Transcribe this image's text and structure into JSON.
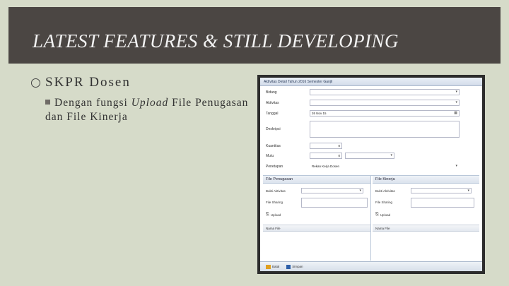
{
  "slide": {
    "title": "LATEST FEATURES & STILL DEVELOPING",
    "bullet_main": "SKPR Dosen",
    "bullet_sub_prefix": "Dengan fungsi ",
    "bullet_sub_emph": "Upload",
    "bullet_sub_suffix": " File Penugasan dan File Kinerja"
  },
  "window": {
    "title": "Aktivitas Detail Tahun 2016 Semester Ganjil",
    "fields": {
      "bidang_label": "Bidang",
      "bidang_value": "",
      "aktivitas_label": "Aktivitas",
      "aktivitas_value": "",
      "tanggal_label": "Tanggal",
      "tanggal_value": "26 Nov 15",
      "deskripsi_label": "Deskripsi",
      "deskripsi_value": "",
      "kuantitas_label": "Kuantitas",
      "kuantitas_value": "0",
      "mutu_label": "Mutu",
      "mutu_value": "0",
      "penetapan_label": "Penetapan",
      "penetapan_value": "Rekan Kerja Dosen"
    },
    "file_penugasan": {
      "header": "File Penugasan",
      "bukti_label": "Bukti Aktivitas",
      "sharing_label": "File Sharing",
      "upload_label": "Upload",
      "grid_header": "Nama File"
    },
    "file_kinerja": {
      "header": "File Kinerja",
      "bukti_label": "Bukti Aktivitas",
      "sharing_label": "File Sharing",
      "upload_label": "Upload",
      "grid_header": "Nama File"
    },
    "footer": {
      "exit_label": "Batal",
      "save_label": "Simpan"
    }
  }
}
